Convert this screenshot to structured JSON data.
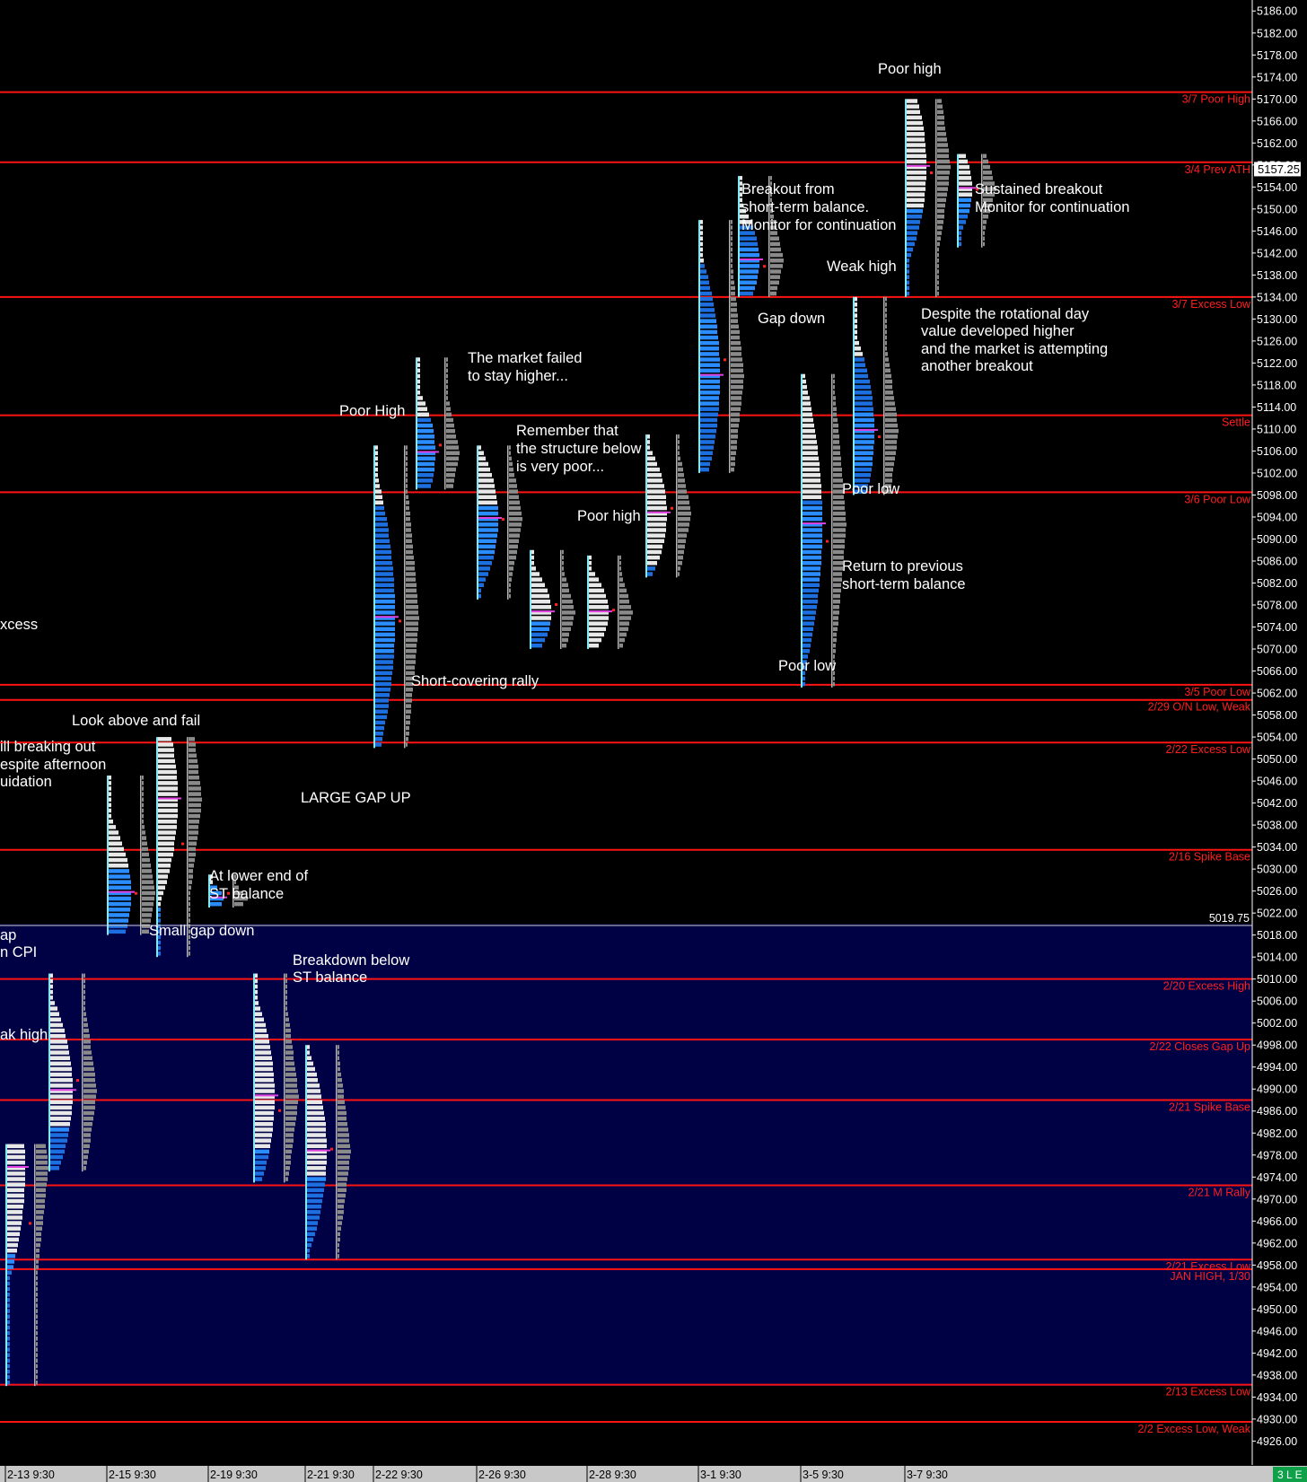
{
  "chart_data": {
    "type": "market_profile",
    "y_axis": {
      "min": 4924,
      "max": 5186,
      "step": 4,
      "decimals": 2
    },
    "current_price": "5157.25",
    "marker_price": "5019.75",
    "x_ticks": [
      "2-13 9:30",
      "2-15 9:30",
      "2-19 9:30",
      "2-21 9:30",
      "2-22 9:30",
      "2-26 9:30",
      "2-28 9:30",
      "3-1 9:30",
      "3-5 9:30",
      "3-7 9:30"
    ],
    "corner_badge": "3 L E",
    "balance_zone": {
      "from": 4936,
      "to": 5020
    },
    "levels": [
      {
        "price": 5171.25,
        "label": "3/7 Poor High"
      },
      {
        "price": 5158.5,
        "label": "3/4 Prev ATH"
      },
      {
        "price": 5134,
        "label": "3/7 Excess Low"
      },
      {
        "price": 5112.5,
        "label": "Settle"
      },
      {
        "price": 5098.5,
        "label": "3/6 Poor Low"
      },
      {
        "price": 5063.5,
        "label": "3/5 Poor Low"
      },
      {
        "price": 5060.75,
        "label": "2/29 O/N Low, Weak"
      },
      {
        "price": 5053,
        "label": "2/22 Excess Low"
      },
      {
        "price": 5033.5,
        "label": "2/16 Spike Base"
      },
      {
        "price": 5010,
        "label": "2/20 Excess High"
      },
      {
        "price": 4999,
        "label": "2/22 Closes Gap Up"
      },
      {
        "price": 4988,
        "label": "2/21 Spike Base"
      },
      {
        "price": 4972.5,
        "label": "2/21 M Rally"
      },
      {
        "price": 4959,
        "label": "2/21 Excess Low"
      },
      {
        "price": 4957.25,
        "label": "JAN HIGH, 1/30"
      },
      {
        "price": 4936.25,
        "label": "2/13 Excess Low"
      },
      {
        "price": 4929.5,
        "label": "2/2 Excess Low, Weak"
      }
    ],
    "profiles": [
      {
        "x": 8,
        "high": 4980,
        "low": 4936,
        "vah": 4973,
        "val": 4958,
        "poc": 4976,
        "split": 4960,
        "hist": [
          20,
          -14
        ]
      },
      {
        "x": 56,
        "high": 5011,
        "low": 4975,
        "vah": 5000,
        "val": 4983,
        "poc": 4990,
        "split": 4983,
        "hist": [
          25,
          -15
        ]
      },
      {
        "x": 121,
        "high": 5047,
        "low": 5018,
        "vah": 5030,
        "val": 5021,
        "poc": 5026,
        "split": 5030,
        "hist": [
          25,
          -15
        ]
      },
      {
        "x": 176,
        "high": 5054,
        "low": 5014,
        "vah": 5046,
        "val": 5023,
        "poc": 5043,
        "split": 5023,
        "hist": [
          22,
          -15
        ]
      },
      {
        "x": 234,
        "high": 5029,
        "low": 5023,
        "vah": 5027,
        "val": 5024,
        "poc": 5025,
        "split": 5027,
        "hist": [
          15,
          -15
        ]
      },
      {
        "x": 284,
        "high": 5011,
        "low": 4973,
        "vah": 4993,
        "val": 4979,
        "poc": 4989,
        "split": 4979,
        "hist": [
          22,
          -15
        ]
      },
      {
        "x": 342,
        "high": 4998,
        "low": 4959,
        "vah": 4984,
        "val": 4974,
        "poc": 4979,
        "split": 4974,
        "hist": [
          22,
          -15
        ]
      },
      {
        "x": 418,
        "high": 5107,
        "low": 5052,
        "vah": 5080,
        "val": 5070,
        "poc": 5076,
        "split": 5096,
        "hist": [
          22,
          -15
        ]
      },
      {
        "x": 465,
        "high": 5123,
        "low": 5099,
        "vah": 5111,
        "val": 5103,
        "poc": 5106,
        "split": 5112,
        "hist": [
          20,
          -15
        ]
      },
      {
        "x": 533,
        "high": 5107,
        "low": 5079,
        "vah": 5099,
        "val": 5088,
        "poc": 5094,
        "split": 5096,
        "hist": [
          22,
          -15
        ]
      },
      {
        "x": 592,
        "high": 5088,
        "low": 5070,
        "vah": 5082,
        "val": 5074,
        "poc": 5077,
        "split": 5075,
        "hist": [
          22,
          -15
        ]
      },
      {
        "x": 656,
        "high": 5087,
        "low": 5070,
        "vah": 5080,
        "val": 5074,
        "poc": 5077,
        "split": 5070,
        "hist": [
          22,
          -15
        ]
      },
      {
        "x": 721,
        "high": 5109,
        "low": 5083,
        "vah": 5099,
        "val": 5092,
        "poc": 5095,
        "split": 5085,
        "hist": [
          22,
          -15
        ]
      },
      {
        "x": 780,
        "high": 5148,
        "low": 5102,
        "vah": 5130,
        "val": 5115,
        "poc": 5120,
        "split": 5140,
        "hist": [
          22,
          -15
        ]
      },
      {
        "x": 824,
        "high": 5156,
        "low": 5134,
        "vah": 5143,
        "val": 5136,
        "poc": 5141,
        "split": 5147,
        "hist": [
          22,
          -15
        ]
      },
      {
        "x": 894,
        "high": 5120,
        "low": 5063,
        "vah": 5096,
        "val": 5083,
        "poc": 5093,
        "split": 5097,
        "hist": [
          22,
          -15
        ]
      },
      {
        "x": 952,
        "high": 5134,
        "low": 5098,
        "vah": 5113,
        "val": 5104,
        "poc": 5110,
        "split": 5123,
        "hist": [
          22,
          -15
        ]
      },
      {
        "x": 1010,
        "high": 5170,
        "low": 5134,
        "vah": 5163,
        "val": 5150,
        "poc": 5158,
        "split": 5150,
        "hist": [
          22,
          -15
        ]
      },
      {
        "x": 1068,
        "high": 5160,
        "low": 5143,
        "vah": 5157,
        "val": 5150,
        "poc": 5154,
        "split": 5152,
        "hist": [
          15,
          -15
        ]
      }
    ],
    "annotations": [
      {
        "text": "Poor high",
        "x": 978,
        "y": 82
      },
      {
        "text": "Breakout from",
        "x": 826,
        "y": 216
      },
      {
        "text": "short-term balance.",
        "x": 826,
        "y": 236
      },
      {
        "text": "Monitor for continuation",
        "x": 826,
        "y": 256
      },
      {
        "text": "Sustained breakout",
        "x": 1086,
        "y": 216
      },
      {
        "text": "Monitor for continuation",
        "x": 1086,
        "y": 236
      },
      {
        "text": "Weak high",
        "x": 921,
        "y": 302
      },
      {
        "text": "Gap down",
        "x": 844,
        "y": 360
      },
      {
        "text": "Despite the rotational day",
        "x": 1026,
        "y": 355
      },
      {
        "text": "value developed higher",
        "x": 1026,
        "y": 374
      },
      {
        "text": "and the market is attempting",
        "x": 1026,
        "y": 394
      },
      {
        "text": "another breakout",
        "x": 1026,
        "y": 413
      },
      {
        "text": "The market failed",
        "x": 521,
        "y": 404
      },
      {
        "text": "to stay higher...",
        "x": 521,
        "y": 424
      },
      {
        "text": "Poor High",
        "x": 378,
        "y": 463
      },
      {
        "text": "Remember that",
        "x": 575,
        "y": 485
      },
      {
        "text": "the structure below",
        "x": 575,
        "y": 505
      },
      {
        "text": "is very poor...",
        "x": 575,
        "y": 525
      },
      {
        "text": "Poor low",
        "x": 938,
        "y": 550
      },
      {
        "text": "Poor high",
        "x": 643,
        "y": 580
      },
      {
        "text": "Return to previous",
        "x": 938,
        "y": 636
      },
      {
        "text": "short-term balance",
        "x": 938,
        "y": 656
      },
      {
        "text": "xcess",
        "x": 0,
        "y": 701
      },
      {
        "text": "Poor low",
        "x": 867,
        "y": 747
      },
      {
        "text": "Short-covering rally",
        "x": 458,
        "y": 764
      },
      {
        "text": "Look above and fail",
        "x": 80,
        "y": 808
      },
      {
        "text": "ill breaking out",
        "x": 0,
        "y": 837
      },
      {
        "text": "espite afternoon",
        "x": 0,
        "y": 857
      },
      {
        "text": "uidation",
        "x": 0,
        "y": 876
      },
      {
        "text": "LARGE GAP UP",
        "x": 335,
        "y": 894
      },
      {
        "text": "At lower end of",
        "x": 233,
        "y": 981
      },
      {
        "text": "ST balance",
        "x": 233,
        "y": 1001
      },
      {
        "text": "Small gap down",
        "x": 166,
        "y": 1042
      },
      {
        "text": "ap",
        "x": 0,
        "y": 1047
      },
      {
        "text": "n CPI",
        "x": 0,
        "y": 1066
      },
      {
        "text": "Breakdown below",
        "x": 326,
        "y": 1075
      },
      {
        "text": "ST balance",
        "x": 326,
        "y": 1094
      },
      {
        "text": "ak high",
        "x": 0,
        "y": 1158
      }
    ]
  }
}
